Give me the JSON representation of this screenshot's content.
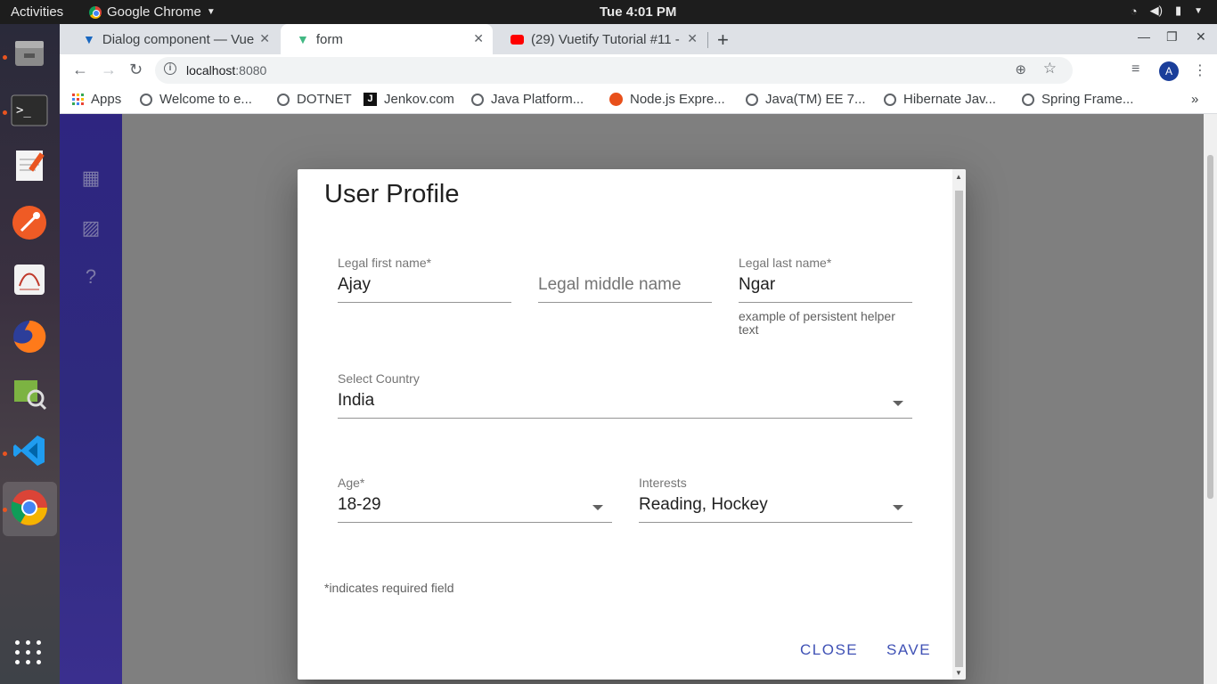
{
  "topbar": {
    "activities": "Activities",
    "app_name": "Google Chrome",
    "clock": "Tue  4:01 PM"
  },
  "browser": {
    "tabs": [
      {
        "title": "Dialog component — Vue",
        "icon": "vuetify-icon"
      },
      {
        "title": "form",
        "icon": "vue-icon"
      },
      {
        "title": "(29) Vuetify Tutorial #11 -",
        "icon": "youtube-icon"
      }
    ],
    "url_host": "localhost",
    "url_port": ":8080",
    "avatar_letter": "A"
  },
  "bookmarks": [
    {
      "label": "Apps"
    },
    {
      "label": "Welcome to e..."
    },
    {
      "label": "DOTNET"
    },
    {
      "label": "Jenkov.com"
    },
    {
      "label": "Java Platform..."
    },
    {
      "label": "Node.js Expre..."
    },
    {
      "label": "Java(TM) EE 7..."
    },
    {
      "label": "Hibernate Jav..."
    },
    {
      "label": "Spring Frame..."
    }
  ],
  "dialog": {
    "title": "User Profile",
    "first_name": {
      "label": "Legal first name*",
      "value": "Ajay"
    },
    "middle_name": {
      "placeholder": "Legal middle name"
    },
    "last_name": {
      "label": "Legal last name*",
      "value": "Ngar",
      "hint": "example of persistent helper text"
    },
    "country": {
      "label": "Select Country",
      "value": "India"
    },
    "age": {
      "label": "Age*",
      "value": "18-29"
    },
    "interests": {
      "label": "Interests",
      "value": "Reading, Hockey"
    },
    "required_note": "*indicates required field",
    "close_label": "CLOSE",
    "save_label": "SAVE"
  },
  "colors": {
    "accent": "#3f51b5",
    "sidebar": "#2e2580"
  }
}
